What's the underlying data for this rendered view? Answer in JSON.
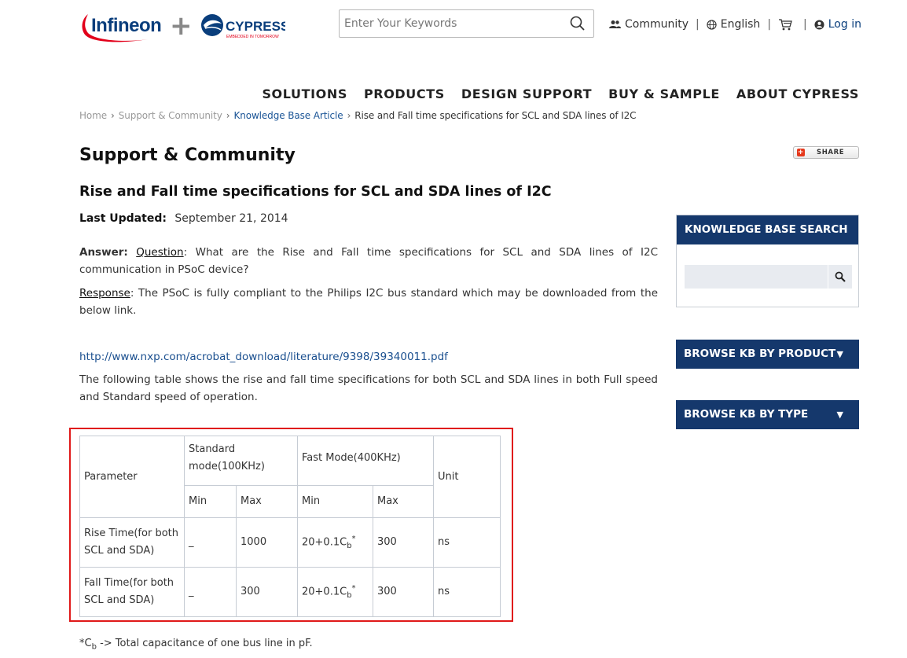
{
  "header": {
    "logos": {
      "infineon": "Infineon",
      "plus": "+",
      "cypress": "CYPRESS",
      "cypress_tagline": "EMBEDDED IN TOMORROW"
    },
    "search": {
      "placeholder": "Enter Your Keywords",
      "value": ""
    },
    "links": {
      "community": "Community",
      "language": "English",
      "cart_icon": "cart-icon",
      "login": "Log in",
      "separator": "|"
    }
  },
  "nav": {
    "items": [
      "SOLUTIONS",
      "PRODUCTS",
      "DESIGN SUPPORT",
      "BUY & SAMPLE",
      "ABOUT CYPRESS"
    ]
  },
  "breadcrumb": {
    "home": "Home",
    "support": "Support & Community",
    "kb": "Knowledge Base Article",
    "current": "Rise and Fall time specifications for SCL and SDA lines of I2C",
    "arrow": "›"
  },
  "page": {
    "title": "Support & Community",
    "share_label": "SHARE",
    "article_title": "Rise and Fall time specifications for SCL and SDA lines of I2C",
    "last_updated_label": "Last Updated:",
    "last_updated_value": "September 21, 2014",
    "answer_label": "Answer:",
    "question_label": "Question",
    "question_text": ": What are the Rise and Fall time specifications for SCL and SDA lines of I2C communication in PSoC device?",
    "response_label": "Response",
    "response_text": ": The PSoC is fully compliant to the Philips I2C bus standard which may be downloaded from the below link.",
    "link": "http://www.nxp.com/acrobat_download/literature/9398/39340011.pdf",
    "table_intro": "The following table shows the rise and fall time specifications for both SCL and SDA lines in both Full speed and Standard speed of operation."
  },
  "table": {
    "header": {
      "parameter": "Parameter",
      "standard_line1": "Standard",
      "standard_line2": "mode(100KHz)",
      "fast": "Fast Mode(400KHz)",
      "unit": "Unit",
      "min": "Min",
      "max": "Max"
    },
    "rows": [
      {
        "param_line1": "Rise Time(for both",
        "param_line2": "SCL and SDA)",
        "std_min": "_",
        "std_max": "1000",
        "fast_min_prefix": "20+0.1C",
        "fast_min_sub": "b",
        "fast_min_sup": "*",
        "fast_max": "300",
        "unit": "ns"
      },
      {
        "param_line1": "Fall Time(for both",
        "param_line2": "SCL and SDA)",
        "std_min": "_",
        "std_max": "300",
        "fast_min_prefix": "20+0.1C",
        "fast_min_sub": "b",
        "fast_min_sup": "*",
        "fast_max": "300",
        "unit": "ns"
      }
    ]
  },
  "footnote": {
    "prefix": "*C",
    "sub": "b",
    "text": " -> Total capacitance of one bus line in pF."
  },
  "sidebar": {
    "kb_search_title": "KNOWLEDGE BASE SEARCH",
    "kb_search_value": "",
    "browse_product": "BROWSE KB BY PRODUCT",
    "browse_type": "BROWSE KB BY TYPE",
    "caret": "▼"
  },
  "colors": {
    "navy": "#15386c",
    "link": "#1a4f8f",
    "highlight_border": "#e01919"
  }
}
